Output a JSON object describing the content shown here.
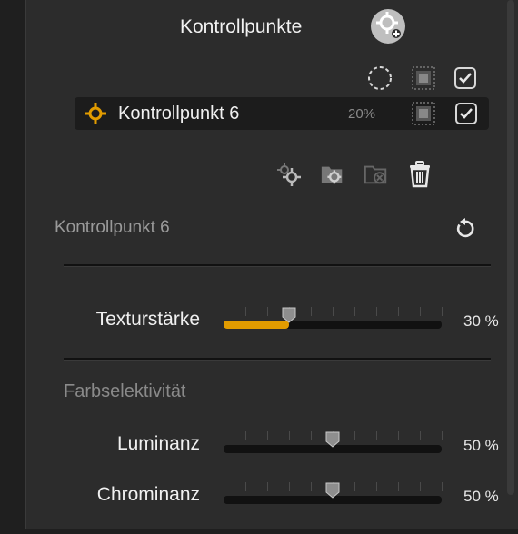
{
  "panel": {
    "title": "Kontrollpunkte"
  },
  "control_point": {
    "name": "Kontrollpunkt 6",
    "opacity": "20%",
    "enabled": true
  },
  "section": {
    "title": "Kontrollpunkt 6"
  },
  "sliders": {
    "texture": {
      "label": "Texturstärke",
      "value": "30 %",
      "level": 0.3
    },
    "color_sel_title": "Farbselektivität",
    "luminance": {
      "label": "Luminanz",
      "value": "50 %",
      "level": 0.5
    },
    "chrominance": {
      "label": "Chrominanz",
      "value": "50 %",
      "level": 0.5
    }
  },
  "colors": {
    "accent": "#e29c00",
    "panel_bg": "#2c2c2c",
    "row_bg": "#1c1c1c"
  },
  "icons": {
    "add_control_point": "target-plus-icon",
    "show_selection": "dashed-circle-icon",
    "mask": "mask-icon",
    "enable": "checkbox-icon",
    "duplicate": "duplicate-point-icon",
    "group": "group-folder-icon",
    "ungroup": "ungroup-folder-icon",
    "delete": "trash-icon",
    "reset": "reset-icon"
  }
}
